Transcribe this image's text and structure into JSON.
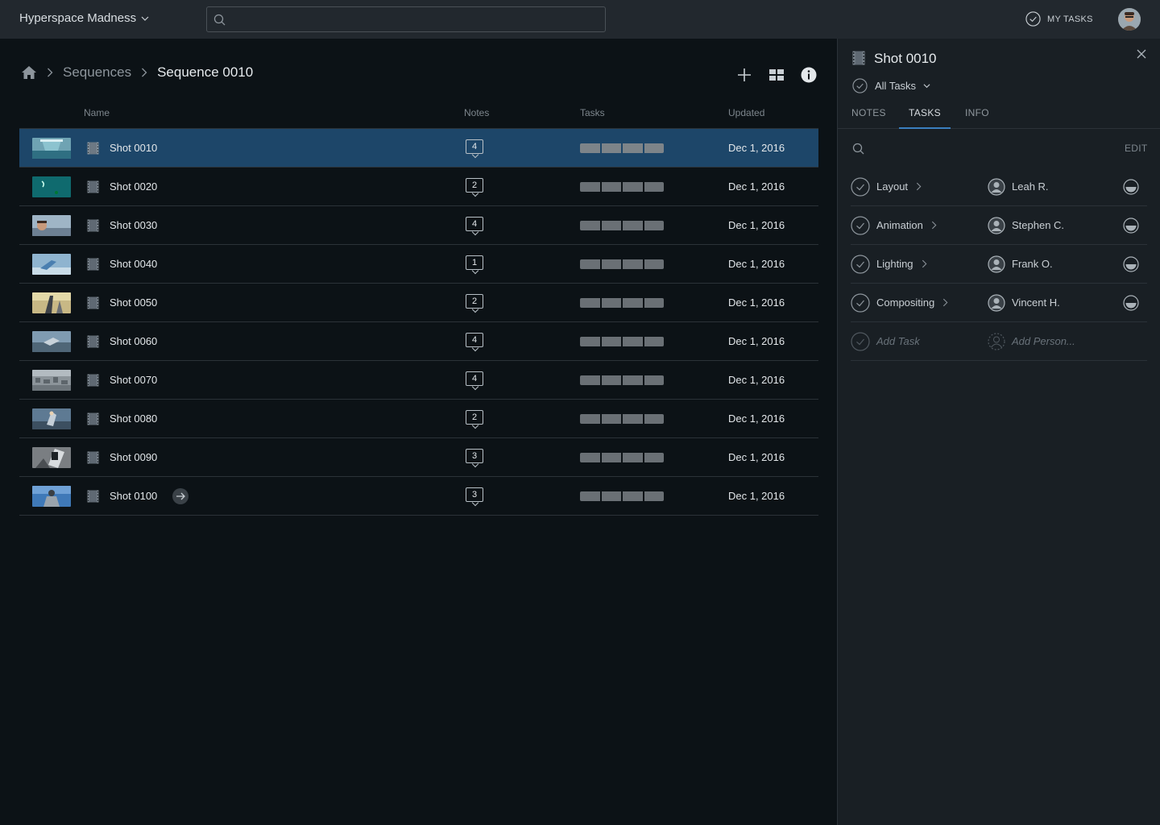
{
  "topbar": {
    "project_name": "Hyperspace Madness",
    "search_placeholder": "",
    "my_tasks_label": "MY TASKS"
  },
  "breadcrumb": {
    "items": [
      "Sequences"
    ],
    "current": "Sequence 0010"
  },
  "columns": {
    "name": "Name",
    "notes": "Notes",
    "tasks": "Tasks",
    "updated": "Updated"
  },
  "shots": [
    {
      "name": "Shot 0010",
      "notes": "4",
      "updated": "Dec 1, 2016",
      "selected": true
    },
    {
      "name": "Shot 0020",
      "notes": "2",
      "updated": "Dec 1, 2016"
    },
    {
      "name": "Shot 0030",
      "notes": "4",
      "updated": "Dec 1, 2016"
    },
    {
      "name": "Shot 0040",
      "notes": "1",
      "updated": "Dec 1, 2016"
    },
    {
      "name": "Shot 0050",
      "notes": "2",
      "updated": "Dec 1, 2016"
    },
    {
      "name": "Shot 0060",
      "notes": "4",
      "updated": "Dec 1, 2016"
    },
    {
      "name": "Shot 0070",
      "notes": "4",
      "updated": "Dec 1, 2016"
    },
    {
      "name": "Shot 0080",
      "notes": "2",
      "updated": "Dec 1, 2016"
    },
    {
      "name": "Shot 0090",
      "notes": "3",
      "updated": "Dec 1, 2016"
    },
    {
      "name": "Shot 0100",
      "notes": "3",
      "updated": "Dec 1, 2016",
      "has_arrow": true
    }
  ],
  "panel": {
    "title": "Shot 0010",
    "filter": "All Tasks",
    "tabs": [
      "NOTES",
      "TASKS",
      "INFO"
    ],
    "active_tab": "TASKS",
    "edit_label": "EDIT",
    "tasks": [
      {
        "name": "Layout",
        "person": "Leah R."
      },
      {
        "name": "Animation",
        "person": "Stephen C."
      },
      {
        "name": "Lighting",
        "person": "Frank O."
      },
      {
        "name": "Compositing",
        "person": "Vincent H."
      }
    ],
    "add_task_placeholder": "Add Task",
    "add_person_placeholder": "Add Person..."
  },
  "colors": {
    "selected_row": "#1d4669",
    "active_tab_underline": "#3a7fbf",
    "background": "#0c1216",
    "panel": "#191f24",
    "topbar": "#22282e"
  }
}
